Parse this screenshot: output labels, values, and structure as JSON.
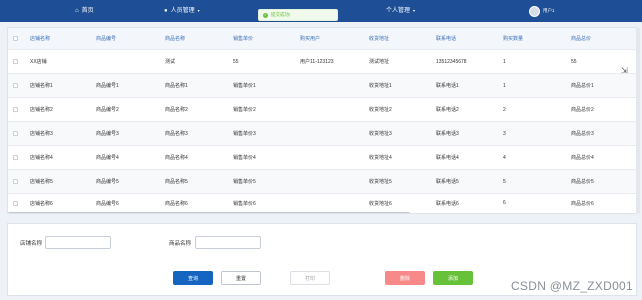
{
  "nav": {
    "home": "首页",
    "staff_mgmt": "人员管理",
    "personal_mgmt": "个人管理",
    "user": "用户1"
  },
  "toast": {
    "message": "提交成功!"
  },
  "table": {
    "headers": [
      "店铺名称",
      "商品编号",
      "商品名称",
      "销售单价",
      "购买用户",
      "收货地址",
      "联系电话",
      "购买数量",
      "商品总价"
    ],
    "rows": [
      [
        "XX店铺",
        "",
        "测试",
        "55",
        "用户11-123123",
        "测试地址",
        "13512345678",
        "1",
        "55"
      ],
      [
        "店铺名称1",
        "商品编号1",
        "商品名称1",
        "销售单价1",
        "",
        "收货地址1",
        "联系电话1",
        "1",
        "商品总价1"
      ],
      [
        "店铺名称2",
        "商品编号2",
        "商品名称2",
        "销售单价2",
        "",
        "收货地址2",
        "联系电话2",
        "2",
        "商品总价2"
      ],
      [
        "店铺名称3",
        "商品编号3",
        "商品名称3",
        "销售单价3",
        "",
        "收货地址3",
        "联系电话3",
        "3",
        "商品总价3"
      ],
      [
        "店铺名称4",
        "商品编号4",
        "商品名称4",
        "销售单价4",
        "",
        "收货地址4",
        "联系电话4",
        "4",
        "商品总价4"
      ],
      [
        "店铺名称5",
        "商品编号5",
        "商品名称5",
        "销售单价5",
        "",
        "收货地址5",
        "联系电话5",
        "5",
        "商品总价5"
      ],
      [
        "店铺名称6",
        "商品编号6",
        "商品名称6",
        "销售单价6",
        "",
        "收货地址6",
        "联系电话6",
        "6",
        "商品总价6"
      ]
    ]
  },
  "search": {
    "shop_label": "店铺名称",
    "product_label": "商品名称",
    "shop_value": "",
    "product_value": ""
  },
  "buttons": {
    "query": "查询",
    "reset": "重置",
    "print": "打印",
    "delete": "删除",
    "add": "添加"
  },
  "watermark": "CSDN @MZ_ZXD001",
  "colors": {
    "nav_bg": "#1e4e96",
    "header_text": "#3a6fb8",
    "primary": "#1565c0",
    "danger": "#f78989",
    "success": "#67c23a"
  }
}
